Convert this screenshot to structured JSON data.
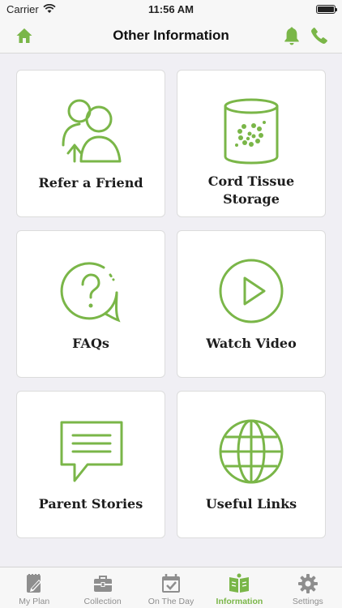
{
  "status_bar": {
    "carrier": "Carrier",
    "time": "11:56 AM"
  },
  "nav": {
    "title": "Other Information"
  },
  "accent_color": "#7ab648",
  "cards": [
    {
      "label": "Refer a Friend",
      "icon": "refer-friend-icon"
    },
    {
      "label": "Cord Tissue Storage",
      "icon": "storage-jar-icon"
    },
    {
      "label": "FAQs",
      "icon": "question-bubble-icon"
    },
    {
      "label": "Watch Video",
      "icon": "play-circle-icon"
    },
    {
      "label": "Parent Stories",
      "icon": "message-bubble-icon"
    },
    {
      "label": "Useful Links",
      "icon": "globe-icon"
    }
  ],
  "tabs": [
    {
      "label": "My Plan",
      "icon": "notebook-icon",
      "active": false
    },
    {
      "label": "Collection",
      "icon": "briefcase-icon",
      "active": false
    },
    {
      "label": "On The Day",
      "icon": "calendar-check-icon",
      "active": false
    },
    {
      "label": "Information",
      "icon": "book-info-icon",
      "active": true
    },
    {
      "label": "Settings",
      "icon": "gear-icon",
      "active": false
    }
  ]
}
